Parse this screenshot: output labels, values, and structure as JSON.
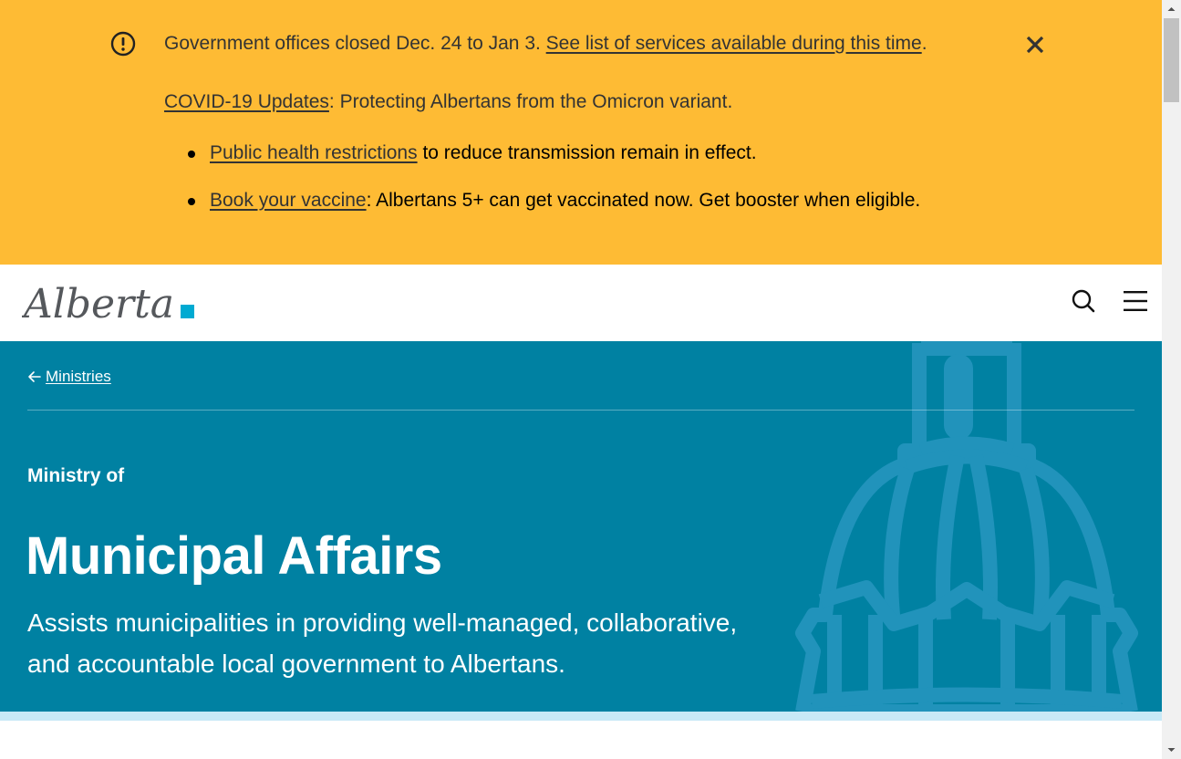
{
  "alert": {
    "line1_text": "Government offices closed Dec. 24 to Jan 3. ",
    "line1_link": "See list of services available during this time",
    "line1_end": ".",
    "line2_link": "COVID-19 Updates",
    "line2_text": ": Protecting Albertans from the Omicron variant.",
    "items": [
      {
        "link": "Public health restrictions",
        "text": " to reduce transmission remain in effect."
      },
      {
        "link": "Book your vaccine",
        "text": ": Albertans 5+ can get vaccinated now. Get booster when eligible."
      }
    ],
    "icon": "exclamation-circle-icon",
    "close_icon": "close-icon",
    "colors": {
      "background": "#febb34",
      "text": "#333333"
    }
  },
  "header": {
    "logo_text": "Alberta",
    "search_icon": "search-icon",
    "menu_icon": "hamburger-menu-icon"
  },
  "hero": {
    "breadcrumb": "Ministries",
    "kicker": "Ministry of",
    "title": "Municipal Affairs",
    "description": "Assists municipalities in providing well-managed, collaborative, and accountable local government to Albertans.",
    "colors": {
      "background": "#0081a2",
      "stripe": "#c8e9f6",
      "logo_accent": "#00aad2"
    }
  }
}
